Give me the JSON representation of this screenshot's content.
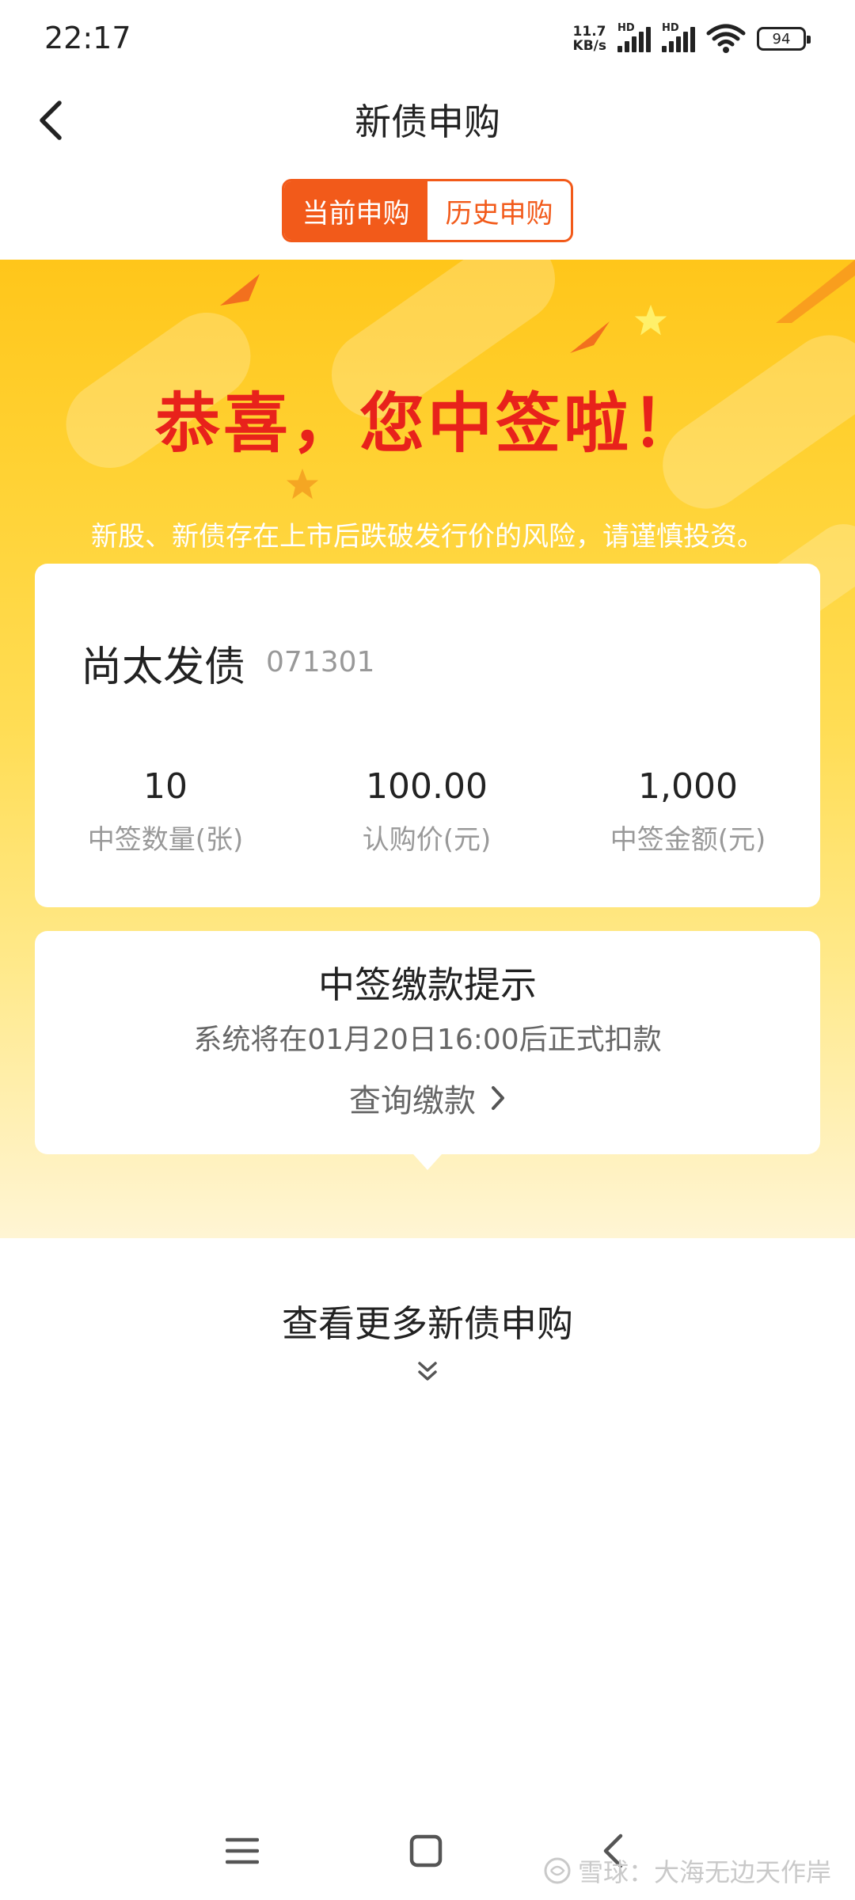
{
  "status_bar": {
    "time": "22:17",
    "net_speed_value": "11.7",
    "net_speed_unit": "KB/s",
    "signal_label": "HD",
    "battery": "94"
  },
  "header": {
    "title": "新债申购",
    "back_icon": "chevron-left-icon"
  },
  "tabs": [
    {
      "label": "当前申购",
      "active": true
    },
    {
      "label": "历史申购",
      "active": false
    }
  ],
  "banner": {
    "congrats": "恭喜，您中签啦！",
    "risk_notice": "新股、新债存在上市后跌破发行价的风险，请谨慎投资。"
  },
  "result_card": {
    "bond_name": "尚太发债",
    "bond_code": "071301",
    "stats": [
      {
        "value": "10",
        "label": "中签数量(张)"
      },
      {
        "value": "100.00",
        "label": "认购价(元)"
      },
      {
        "value": "1,000",
        "label": "中签金额(元)"
      }
    ]
  },
  "payment_card": {
    "title": "中签缴款提示",
    "description": "系统将在01月20日16:00后正式扣款",
    "link_label": "查询缴款"
  },
  "more": {
    "label": "查看更多新债申购",
    "icon": "double-chevron-down-icon"
  },
  "watermark": {
    "text": "雪球：大海无边天作岸"
  },
  "colors": {
    "accent": "#f25a1a",
    "congrats_red": "#e8221b",
    "banner_top": "#ffc61a"
  }
}
